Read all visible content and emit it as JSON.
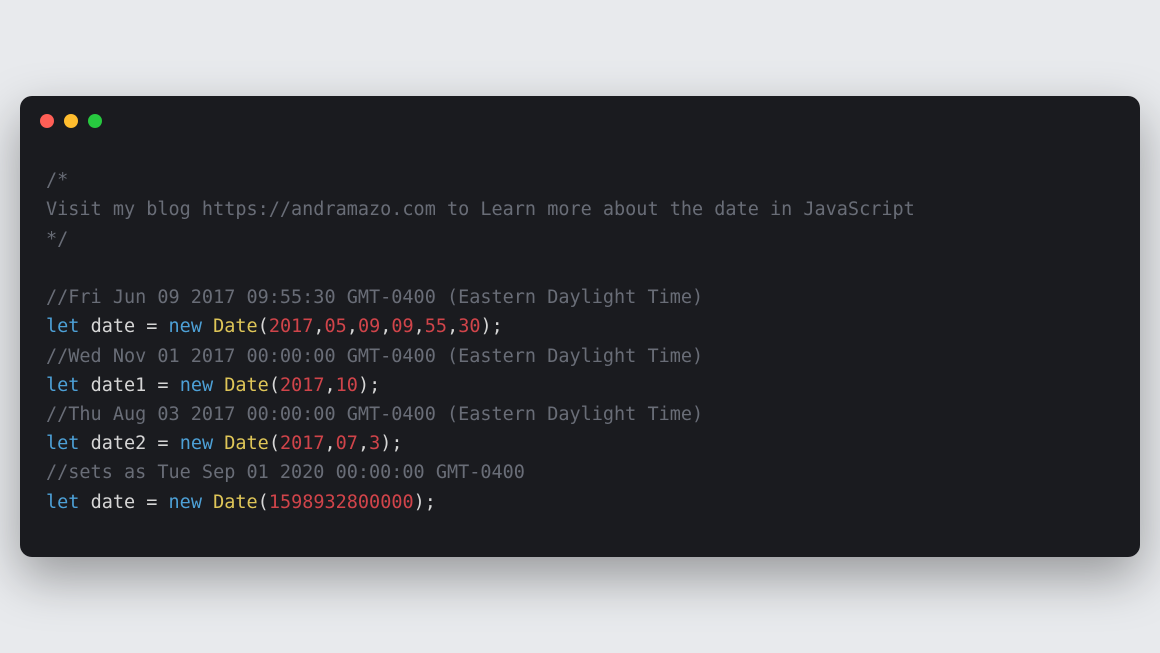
{
  "window": {
    "dots": {
      "red": "#ff5f56",
      "yellow": "#ffbd2e",
      "green": "#27c93f"
    }
  },
  "code": {
    "block1_open": "/*",
    "block1_body": "Visit my blog https://andramazo.com to Learn more about the date in JavaScript",
    "block1_close": "*/",
    "c1": "//Fri Jun 09 2017 09:55:30 GMT-0400 (Eastern Daylight Time)",
    "l1": {
      "kw_let": "let",
      "name": "date",
      "eq": " = ",
      "kw_new": "new",
      "fn": "Date",
      "open": "(",
      "args": [
        "2017",
        "05",
        "09",
        "09",
        "55",
        "30"
      ],
      "close": ");"
    },
    "c2": "//Wed Nov 01 2017 00:00:00 GMT-0400 (Eastern Daylight Time)",
    "l2": {
      "kw_let": "let",
      "name": "date1",
      "eq": " = ",
      "kw_new": "new",
      "fn": "Date",
      "open": "(",
      "args": [
        "2017",
        "10"
      ],
      "close": ");"
    },
    "c3": "//Thu Aug 03 2017 00:00:00 GMT-0400 (Eastern Daylight Time)",
    "l3": {
      "kw_let": "let",
      "name": "date2",
      "eq": " = ",
      "kw_new": "new",
      "fn": "Date",
      "open": "(",
      "args": [
        "2017",
        "07",
        "3"
      ],
      "close": ");"
    },
    "c4": "//sets as Tue Sep 01 2020 00:00:00 GMT-0400",
    "l4": {
      "kw_let": "let",
      "name": "date",
      "eq": " = ",
      "kw_new": "new",
      "fn": "Date",
      "open": "(",
      "args": [
        "1598932800000"
      ],
      "close": ");"
    },
    "comma": ","
  }
}
